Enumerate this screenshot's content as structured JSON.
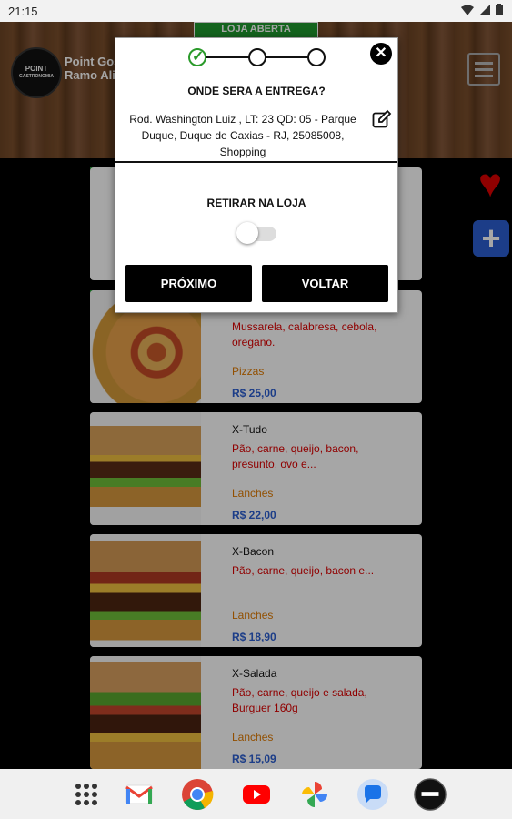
{
  "status_bar": {
    "time": "21:15"
  },
  "store": {
    "logo_line1": "POINT",
    "logo_line2": "GASTRONOMIA",
    "name_line1": "Point Gos",
    "name_line2": "Ramo Ali",
    "badge": "LOJA ABERTA"
  },
  "products": [
    {
      "name": "",
      "desc": "Mussarela, calabresa, cebola, oregano.",
      "category": "Pizzas",
      "price": "R$ 25,00"
    },
    {
      "name": "X-Tudo",
      "desc": "Pão, carne, queijo, bacon, presunto, ovo e...",
      "category": "Lanches",
      "price": "R$ 22,00"
    },
    {
      "name": "X-Bacon",
      "desc": "Pão, carne, queijo, bacon e...",
      "category": "Lanches",
      "price": "R$ 18,90"
    },
    {
      "name": "X-Salada",
      "desc": "Pão, carne, queijo e salada, Burguer 160g",
      "category": "Lanches",
      "price": "R$ 15,09"
    }
  ],
  "modal": {
    "question": "ONDE SERA A ENTREGA?",
    "address": "Rod. Washington Luiz , LT: 23 QD: 05 - Parque Duque, Duque de Caxias - RJ, 25085008, Shopping",
    "pickup_label": "RETIRAR NA LOJA",
    "pickup_enabled": false,
    "next_label": "PRÓXIMO",
    "back_label": "VOLTAR",
    "close_symbol": "✕",
    "steps_completed": 1,
    "steps_total": 3
  },
  "nav_icons": [
    "apps-icon",
    "gmail-icon",
    "chrome-icon",
    "youtube-icon",
    "photos-icon",
    "messages-icon",
    "point-app-icon"
  ],
  "colors": {
    "accent_green": "#1f9a2e",
    "price_blue": "#2b5fd1",
    "desc_red": "#d00000",
    "category_orange": "#e07a00"
  }
}
